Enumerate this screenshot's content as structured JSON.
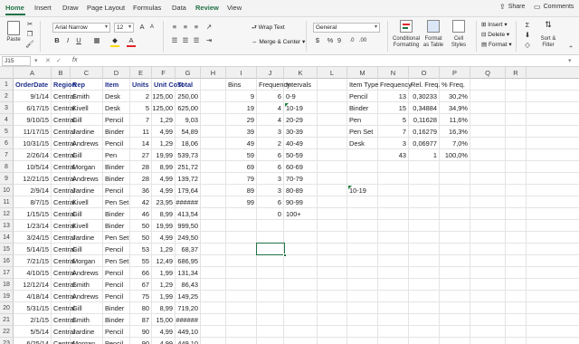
{
  "tabs": [
    "Home",
    "Insert",
    "Draw",
    "Page Layout",
    "Formulas",
    "Data",
    "Review",
    "View"
  ],
  "share_label": "Share",
  "comments_label": "Comments",
  "ribbon": {
    "paste_label": "Paste",
    "font_name": "Arial Narrow",
    "font_size": "12",
    "wrap_text_label": "Wrap Text",
    "merge_center_label": "Merge & Center",
    "number_format": "General",
    "conditional_formatting_label": [
      "Conditional",
      "Formatting"
    ],
    "format_as_table_label": [
      "Format",
      "as Table"
    ],
    "cell_styles_label": [
      "Cell",
      "Styles"
    ],
    "insert_label": "Insert",
    "delete_label": "Delete",
    "format_label": "Format",
    "sort_filter_label": [
      "Sort &",
      "Filter"
    ],
    "percent_symbol": "%",
    "comma_symbol": "9"
  },
  "formula_bar": {
    "name_box": "J15",
    "fx": "fx",
    "formula": ""
  },
  "columns": [
    "A",
    "B",
    "C",
    "D",
    "E",
    "F",
    "G",
    "H",
    "I",
    "J",
    "K",
    "L",
    "M",
    "N",
    "O",
    "P",
    "Q",
    "R"
  ],
  "rows": [
    1,
    2,
    3,
    4,
    5,
    6,
    7,
    8,
    9,
    10,
    11,
    12,
    13,
    14,
    15,
    16,
    17,
    18,
    19,
    20,
    21,
    22,
    23
  ],
  "headers": {
    "orderdate": "OrderDate",
    "region": "Region",
    "rep": "Rep",
    "item": "Item",
    "units": "Units",
    "unitcost": "Unit Cost",
    "total": "Total"
  },
  "orders": [
    {
      "date": "9/1/14",
      "region": "Central",
      "rep": "Smith",
      "item": "Desk",
      "units": "2",
      "cost": "125,00",
      "total": "250,00"
    },
    {
      "date": "6/17/15",
      "region": "Central",
      "rep": "Kivell",
      "item": "Desk",
      "units": "5",
      "cost": "125,00",
      "total": "625,00"
    },
    {
      "date": "9/10/15",
      "region": "Central",
      "rep": "Gill",
      "item": "Pencil",
      "units": "7",
      "cost": "1,29",
      "total": "9,03"
    },
    {
      "date": "11/17/15",
      "region": "Central",
      "rep": "Jardine",
      "item": "Binder",
      "units": "11",
      "cost": "4,99",
      "total": "54,89"
    },
    {
      "date": "10/31/15",
      "region": "Central",
      "rep": "Andrews",
      "item": "Pencil",
      "units": "14",
      "cost": "1,29",
      "total": "18,06"
    },
    {
      "date": "2/26/14",
      "region": "Central",
      "rep": "Gill",
      "item": "Pen",
      "units": "27",
      "cost": "19,99",
      "total": "539,73"
    },
    {
      "date": "10/5/14",
      "region": "Central",
      "rep": "Morgan",
      "item": "Binder",
      "units": "28",
      "cost": "8,99",
      "total": "251,72"
    },
    {
      "date": "12/21/15",
      "region": "Central",
      "rep": "Andrews",
      "item": "Binder",
      "units": "28",
      "cost": "4,99",
      "total": "139,72"
    },
    {
      "date": "2/9/14",
      "region": "Central",
      "rep": "Jardine",
      "item": "Pencil",
      "units": "36",
      "cost": "4,99",
      "total": "179,64"
    },
    {
      "date": "8/7/15",
      "region": "Central",
      "rep": "Kivell",
      "item": "Pen Set",
      "units": "42",
      "cost": "23,95",
      "total": "######"
    },
    {
      "date": "1/15/15",
      "region": "Central",
      "rep": "Gill",
      "item": "Binder",
      "units": "46",
      "cost": "8,99",
      "total": "413,54"
    },
    {
      "date": "1/23/14",
      "region": "Central",
      "rep": "Kivell",
      "item": "Binder",
      "units": "50",
      "cost": "19,99",
      "total": "999,50"
    },
    {
      "date": "3/24/15",
      "region": "Central",
      "rep": "Jardine",
      "item": "Pen Set",
      "units": "50",
      "cost": "4,99",
      "total": "249,50"
    },
    {
      "date": "5/14/15",
      "region": "Central",
      "rep": "Gill",
      "item": "Pencil",
      "units": "53",
      "cost": "1,29",
      "total": "68,37"
    },
    {
      "date": "7/21/15",
      "region": "Central",
      "rep": "Morgan",
      "item": "Pen Set",
      "units": "55",
      "cost": "12,49",
      "total": "686,95"
    },
    {
      "date": "4/10/15",
      "region": "Central",
      "rep": "Andrews",
      "item": "Pencil",
      "units": "66",
      "cost": "1,99",
      "total": "131,34"
    },
    {
      "date": "12/12/14",
      "region": "Central",
      "rep": "Smith",
      "item": "Pencil",
      "units": "67",
      "cost": "1,29",
      "total": "86,43"
    },
    {
      "date": "4/18/14",
      "region": "Central",
      "rep": "Andrews",
      "item": "Pencil",
      "units": "75",
      "cost": "1,99",
      "total": "149,25"
    },
    {
      "date": "5/31/15",
      "region": "Central",
      "rep": "Gill",
      "item": "Binder",
      "units": "80",
      "cost": "8,99",
      "total": "719,20"
    },
    {
      "date": "2/1/15",
      "region": "Central",
      "rep": "Smith",
      "item": "Binder",
      "units": "87",
      "cost": "15,00",
      "total": "######"
    },
    {
      "date": "5/5/14",
      "region": "Central",
      "rep": "Jardine",
      "item": "Pencil",
      "units": "90",
      "cost": "4,99",
      "total": "449,10"
    },
    {
      "date": "6/25/14",
      "region": "Central",
      "rep": "Morgan",
      "item": "Pencil",
      "units": "90",
      "cost": "4,99",
      "total": "449,10"
    }
  ],
  "bins_header": "Bins",
  "frequency_header": "Frequency",
  "intervals_header": "Intervals",
  "bins": [
    {
      "bin": "9",
      "freq": "6",
      "interval": "0-9"
    },
    {
      "bin": "19",
      "freq": "4",
      "interval": "10-19"
    },
    {
      "bin": "29",
      "freq": "4",
      "interval": "20-29"
    },
    {
      "bin": "39",
      "freq": "3",
      "interval": "30-39"
    },
    {
      "bin": "49",
      "freq": "2",
      "interval": "40-49"
    },
    {
      "bin": "59",
      "freq": "6",
      "interval": "50-59"
    },
    {
      "bin": "69",
      "freq": "6",
      "interval": "60-69"
    },
    {
      "bin": "79",
      "freq": "3",
      "interval": "70-79"
    },
    {
      "bin": "89",
      "freq": "3",
      "interval": "80-89"
    },
    {
      "bin": "99",
      "freq": "6",
      "interval": "90-99"
    },
    {
      "bin": "",
      "freq": "0",
      "interval": "100+"
    }
  ],
  "stray_value": "10-19",
  "item_table_headers": {
    "type": "Item Type",
    "freq": "Frequency",
    "rel": "Rel. Freq.",
    "pct": "% Freq."
  },
  "item_table": [
    {
      "type": "Pencil",
      "freq": "13",
      "rel": "0,30233",
      "pct": "30,2%"
    },
    {
      "type": "Binder",
      "freq": "15",
      "rel": "0,34884",
      "pct": "34,9%"
    },
    {
      "type": "Pen",
      "freq": "5",
      "rel": "0,11628",
      "pct": "11,6%"
    },
    {
      "type": "Pen Set",
      "freq": "7",
      "rel": "0,16279",
      "pct": "16,3%"
    },
    {
      "type": "Desk",
      "freq": "3",
      "rel": "0,06977",
      "pct": "7,0%"
    }
  ],
  "item_totals": {
    "freq": "43",
    "rel": "1",
    "pct": "100,0%"
  }
}
